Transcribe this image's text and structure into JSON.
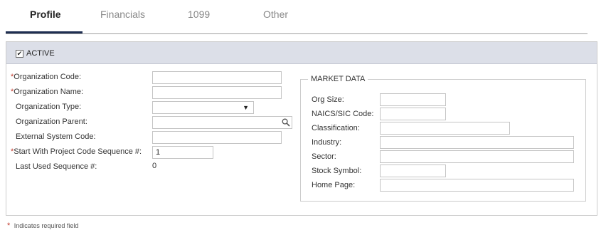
{
  "tabs": [
    {
      "label": "Profile",
      "active": true
    },
    {
      "label": "Financials",
      "active": false
    },
    {
      "label": "1099",
      "active": false
    },
    {
      "label": "Other",
      "active": false
    }
  ],
  "active_section": {
    "checkbox_checked": true,
    "label": "ACTIVE"
  },
  "form": {
    "org_code": {
      "label": "Organization Code:",
      "required": true,
      "value": ""
    },
    "org_name": {
      "label": "Organization Name:",
      "required": true,
      "value": ""
    },
    "org_type": {
      "label": "Organization Type:",
      "value": ""
    },
    "org_parent": {
      "label": "Organization Parent:",
      "value": ""
    },
    "external_code": {
      "label": "External System Code:",
      "value": ""
    },
    "start_seq": {
      "label": "Start With Project Code Sequence #:",
      "required": true,
      "value": "1"
    },
    "last_seq": {
      "label": "Last Used Sequence #:",
      "value": "0"
    }
  },
  "market_data": {
    "title": "MARKET DATA",
    "org_size": {
      "label": "Org Size:",
      "value": ""
    },
    "naics": {
      "label": "NAICS/SIC Code:",
      "value": ""
    },
    "classification": {
      "label": "Classification:",
      "value": ""
    },
    "industry": {
      "label": "Industry:",
      "value": ""
    },
    "sector": {
      "label": "Sector:",
      "value": ""
    },
    "stock_symbol": {
      "label": "Stock Symbol:",
      "value": ""
    },
    "home_page": {
      "label": "Home Page:",
      "value": ""
    }
  },
  "required_marker": "*",
  "check_glyph": "✔",
  "dropdown_glyph": "▼",
  "footnote": "Indicates required field"
}
